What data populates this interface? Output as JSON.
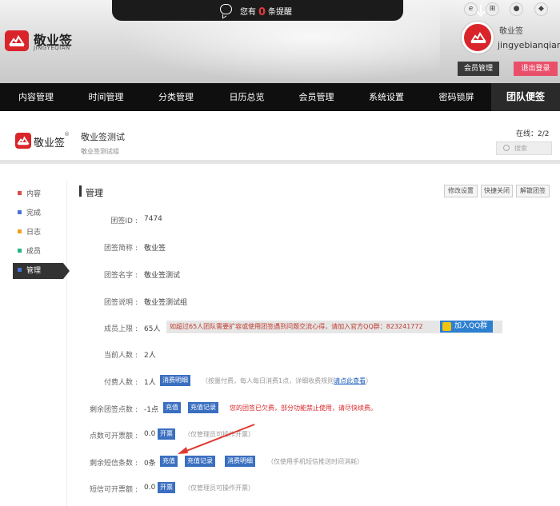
{
  "header": {
    "notice_prefix": "您有",
    "notice_count": "0",
    "notice_suffix": "条提醒",
    "brand_cn": "敬业签",
    "brand_en": "JINGYEQIAN",
    "user_name": "敬业签",
    "user_id": "jingyebianqian",
    "member_btn": "会员管理",
    "logout_btn": "退出登录",
    "platforms": [
      "ie-icon",
      "windows-icon",
      "apple-icon",
      "android-icon"
    ],
    "accent": "#d9252a"
  },
  "nav": {
    "items": [
      "内容管理",
      "时间管理",
      "分类管理",
      "日历总览",
      "会员管理",
      "系统设置",
      "密码锁屏",
      "团队便签"
    ]
  },
  "team": {
    "product": "敬业签",
    "reg": "®",
    "name": "敬业签测试",
    "desc": "敬业签测试组",
    "online": "在线：2/2",
    "search_placeholder": "搜索"
  },
  "sidebar": {
    "items": [
      {
        "label": "内容",
        "color": "#e04b4b"
      },
      {
        "label": "完成",
        "color": "#4a74d4"
      },
      {
        "label": "日志",
        "color": "#f0a020"
      },
      {
        "label": "成员",
        "color": "#25b38a"
      },
      {
        "label": "管理",
        "color": "#4a74d4"
      }
    ]
  },
  "manage": {
    "title": "管理",
    "buttons": [
      "修改设置",
      "快捷关闭",
      "解散团签"
    ],
    "fields": [
      {
        "label": "团签ID",
        "value": "7474"
      },
      {
        "label": "团签简称",
        "value": "敬业签"
      },
      {
        "label": "团签名字",
        "value": "敬业签测试"
      },
      {
        "label": "团签说明",
        "value": "敬业签测试组"
      },
      {
        "label": "成员上限",
        "value": "65人"
      },
      {
        "label": "当前人数",
        "value": "2人"
      },
      {
        "label": "付费人数",
        "value": "1人"
      },
      {
        "label": "剩余团签点数",
        "value": "-1点"
      },
      {
        "label": "点数可开票额",
        "value": "0.0"
      },
      {
        "label": "剩余短信条数",
        "value": "0条"
      },
      {
        "label": "短信可开票额",
        "value": "0.0"
      }
    ],
    "capacity_msg": "如超过65人团队需要扩容或使用团签遇到问题交流心得，请加入官方QQ群：823241772",
    "qq_btn": "加入QQ群",
    "tag_details": "消费明细",
    "tag_recharge": "充值",
    "tag_recharge_log": "充值记录",
    "tag_invoice": "开票",
    "paid_tip_a": "（按量付费，每人每日消费1点，详细收费规则",
    "paid_tip_link": "请点此查看",
    "paid_tip_b": "）",
    "points_warn": "您的团签已欠费，部分功能禁止使用，请尽快续费。",
    "invoice_tip": "（仅管理员可操作开票）",
    "sms_tip": "（仅使用手机短信推送时间消耗）",
    "invoice_tip2": "（仅管理员可操作开票）"
  }
}
